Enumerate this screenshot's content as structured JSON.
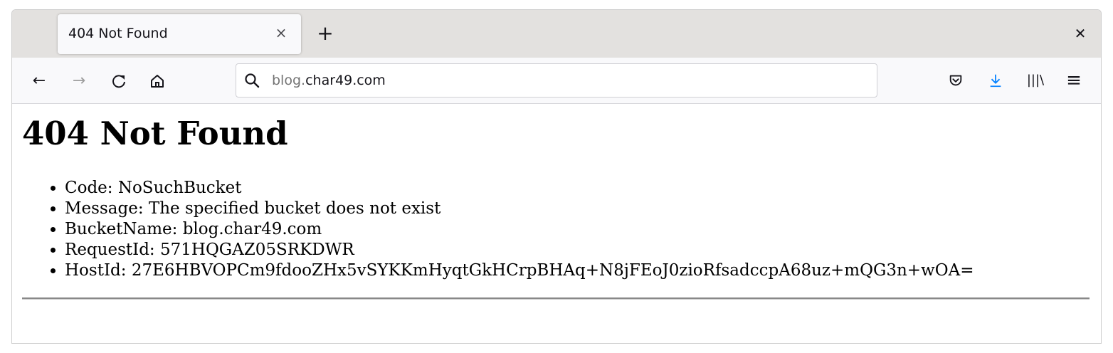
{
  "browser": {
    "tab": {
      "title": "404 Not Found",
      "close_glyph": "×"
    },
    "new_tab_glyph": "+",
    "window_close_glyph": "✕",
    "nav": {
      "back_glyph": "←",
      "forward_glyph": "→",
      "reload_glyph": "C",
      "home_glyph": "⌂"
    },
    "url": {
      "prefix": "blog.",
      "domain": "char49.com"
    },
    "toolbar": {
      "library_glyph": "|||\\",
      "menu_glyph": "≡"
    },
    "colors": {
      "download_accent": "#0a84ff",
      "tabbar": "#e3e1df",
      "navbar": "#f9f9fb"
    }
  },
  "page": {
    "heading": "404 Not Found",
    "details": [
      {
        "text": "Code: NoSuchBucket"
      },
      {
        "text": "Message: The specified bucket does not exist"
      },
      {
        "text": "BucketName: blog.char49.com"
      },
      {
        "text": "RequestId: 571HQGAZ05SRKDWR"
      },
      {
        "text": "HostId: 27E6HBVOPCm9fdooZHx5vSYKKmHyqtGkHCrpBHAq+N8jFEoJ0zioRfsadccpA68uz+mQG3n+wOA="
      }
    ]
  }
}
